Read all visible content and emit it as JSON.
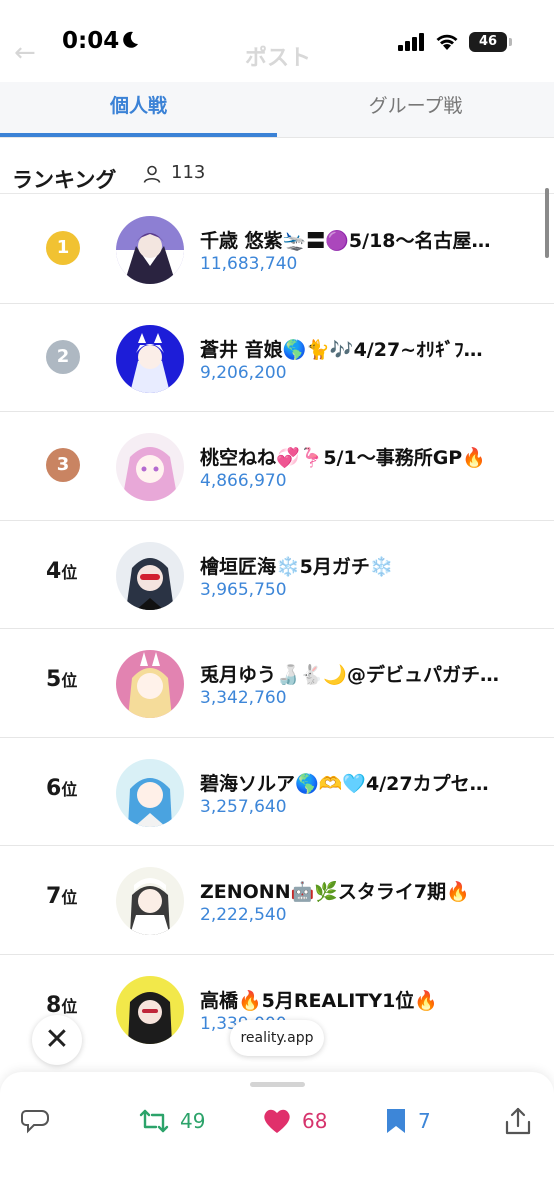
{
  "status_bar": {
    "time": "0:04",
    "battery": "46"
  },
  "background_header": {
    "title": "ポスト"
  },
  "tabs": [
    {
      "label": "個人戦",
      "active": true
    },
    {
      "label": "グループ戦",
      "active": false
    }
  ],
  "ranking": {
    "title": "ランキング",
    "participant_count": "113",
    "entries": [
      {
        "rank": "1",
        "rank_suffix": "",
        "medal": "gold",
        "name": "千歳 悠紫🛬〓🟣5/18〜名古屋…",
        "score": "11,683,740"
      },
      {
        "rank": "2",
        "rank_suffix": "",
        "medal": "silver",
        "name": "蒼井 音娘🌎🐈🎶4/27~ｵﾘｷﾞﾌ…",
        "score": "9,206,200"
      },
      {
        "rank": "3",
        "rank_suffix": "",
        "medal": "bronze",
        "name": "桃空ねね💞🦩5/1〜事務所GP🔥",
        "score": "4,866,970"
      },
      {
        "rank": "4",
        "rank_suffix": "位",
        "medal": "",
        "name": "檜垣匠海❄️5月ガチ❄️",
        "score": "3,965,750"
      },
      {
        "rank": "5",
        "rank_suffix": "位",
        "medal": "",
        "name": "兎月ゆう🍶🐇🌙@デビュパガチ…",
        "score": "3,342,760"
      },
      {
        "rank": "6",
        "rank_suffix": "位",
        "medal": "",
        "name": "碧海ソルア🌎🫶🩵4/27カプセ…",
        "score": "3,257,640"
      },
      {
        "rank": "7",
        "rank_suffix": "位",
        "medal": "",
        "name": "ZENONN🤖🌿スタライ7期🔥",
        "score": "2,222,540"
      },
      {
        "rank": "8",
        "rank_suffix": "位",
        "medal": "",
        "name": "高橋🔥5月REALITY1位🔥",
        "score": "1,339,000"
      }
    ]
  },
  "overlay": {
    "close_label": "✕",
    "domain": "reality.app"
  },
  "actions": {
    "retweets": "49",
    "likes": "68",
    "bookmarks": "7"
  },
  "colors": {
    "accent": "#3b82d6",
    "gold": "#f1c232",
    "silver": "#aeb8c2",
    "bronze": "#c98462",
    "retweet": "#2ca36a",
    "like": "#e0306b"
  }
}
